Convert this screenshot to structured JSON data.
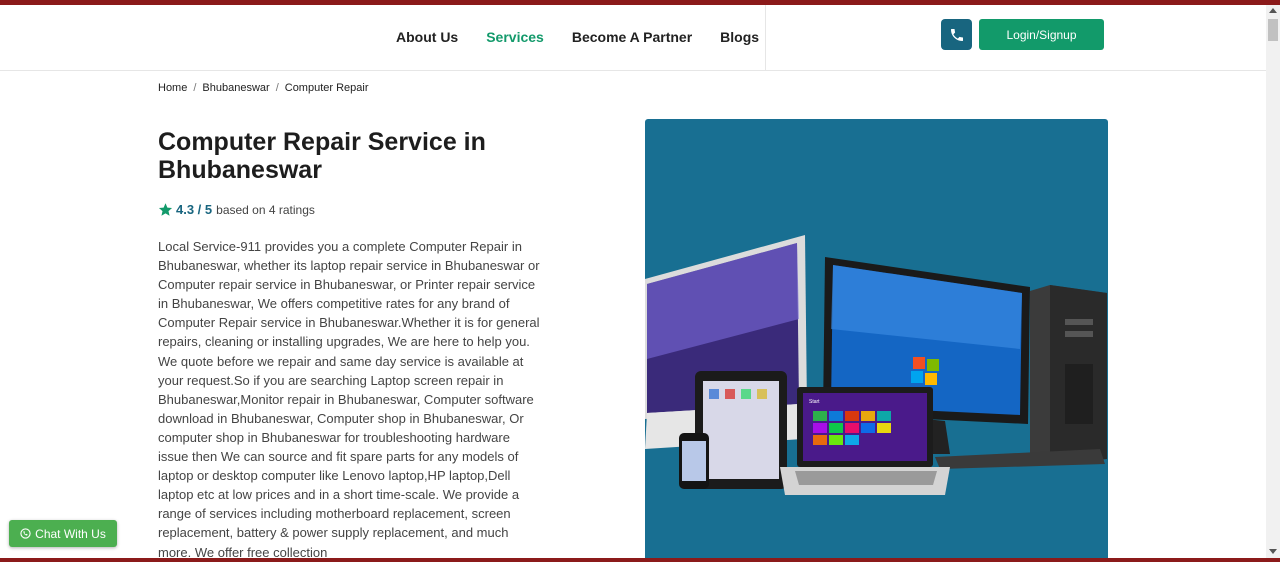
{
  "nav": {
    "items": [
      {
        "label": "About Us"
      },
      {
        "label": "Services"
      },
      {
        "label": "Become A Partner"
      },
      {
        "label": "Blogs"
      }
    ],
    "login_label": "Login/Signup"
  },
  "breadcrumb": {
    "items": [
      "Home",
      "Bhubaneswar",
      "Computer Repair"
    ],
    "separator": "/"
  },
  "main": {
    "title": "Computer Repair Service in Bhubaneswar",
    "rating": {
      "score": "4.3 / 5",
      "based_on": "based on 4 ratings"
    },
    "description": "Local Service-911 provides you a complete Computer Repair in Bhubaneswar, whether its laptop repair service in Bhubaneswar or Computer repair service in Bhubaneswar, or Printer repair service in Bhubaneswar, We offers competitive rates for any brand of Computer Repair service in Bhubaneswar.Whether it is for general repairs, cleaning or installing upgrades, We are here to help you. We quote before we repair and same day service is available at your request.So if you are searching Laptop screen repair in Bhubaneswar,Monitor repair in Bhubaneswar, Computer software download in Bhubaneswar, Computer shop in Bhubaneswar, Or computer shop in Bhubaneswar for troubleshooting hardware issue then We can source and fit spare parts for any models of laptop or desktop computer like Lenovo laptop,HP laptop,Dell laptop etc at low prices and in a short time-scale. We provide a range of services including motherboard replacement, screen replacement, battery & power supply replacement, and much more. We offer free collection"
  },
  "hero": {
    "laptop_screen_text": "Start"
  },
  "chat": {
    "label": "Chat With Us"
  },
  "colors": {
    "accent_green": "#139a6b",
    "accent_blue": "#18657f",
    "brand_red": "#8b1a1a",
    "hero_bg": "#186f92"
  }
}
